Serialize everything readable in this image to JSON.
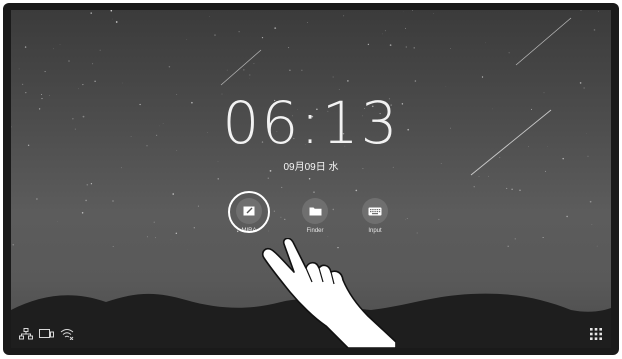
{
  "clock": {
    "time": "06:13",
    "date": "09月09日 水"
  },
  "apps": [
    {
      "label": "MIRA",
      "icon": "whiteboard-icon"
    },
    {
      "label": "Finder",
      "icon": "folder-icon"
    },
    {
      "label": "Input",
      "icon": "keyboard-icon"
    }
  ],
  "status_icons": [
    "network-icon",
    "display-cast-icon",
    "wifi-off-icon"
  ],
  "launcher": {
    "icon": "apps-grid-icon"
  },
  "colors": {
    "bezel": "#1a1a1a",
    "icon_bg": "#6f6f6f",
    "text": "#f2f2f2"
  }
}
